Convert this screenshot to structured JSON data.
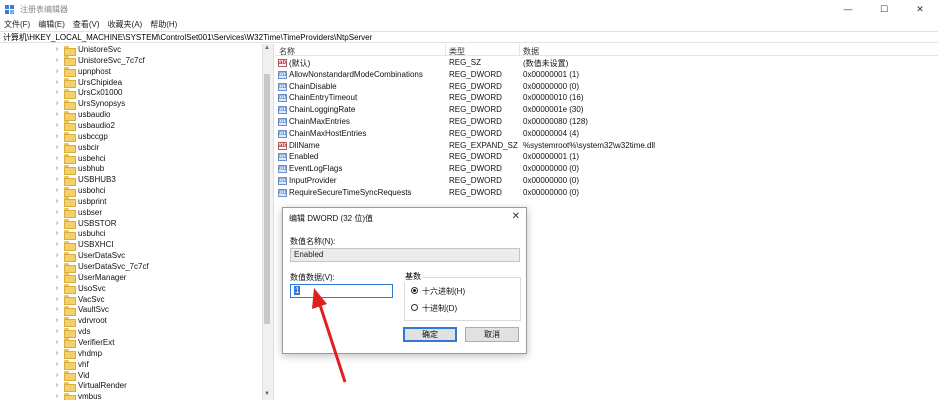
{
  "window": {
    "title": "注册表编辑器",
    "controls": {
      "minimize": "—",
      "maximize": "☐",
      "close": "✕"
    }
  },
  "menu": [
    "文件(F)",
    "编辑(E)",
    "查看(V)",
    "收藏夹(A)",
    "帮助(H)"
  ],
  "address": "计算机\\HKEY_LOCAL_MACHINE\\SYSTEM\\ControlSet001\\Services\\W32Time\\TimeProviders\\NtpServer",
  "tree": {
    "items": [
      "UnistoreSvc",
      "UnistoreSvc_7c7cf",
      "upnphost",
      "UrsChipidea",
      "UrsCx01000",
      "UrsSynopsys",
      "usbaudio",
      "usbaudio2",
      "usbccgp",
      "usbcir",
      "usbehci",
      "usbhub",
      "USBHUB3",
      "usbohci",
      "usbprint",
      "usbser",
      "USBSTOR",
      "usbuhci",
      "USBXHCI",
      "UserDataSvc",
      "UserDataSvc_7c7cf",
      "UserManager",
      "UsoSvc",
      "VacSvc",
      "VaultSvc",
      "vdrvroot",
      "vds",
      "VerifierExt",
      "vhdmp",
      "vhf",
      "Vid",
      "VirtualRender",
      "vmbus"
    ],
    "chevron": "›"
  },
  "values": {
    "headers": {
      "name": "名称",
      "type": "类型",
      "data": "数据"
    },
    "rows": [
      {
        "icon": "string-value-icon",
        "glyph": "ab",
        "name": "(默认)",
        "type": "REG_SZ",
        "data": "(数值未设置)"
      },
      {
        "icon": "dword-value-icon",
        "glyph": "011",
        "name": "AllowNonstandardModeCombinations",
        "type": "REG_DWORD",
        "data": "0x00000001 (1)"
      },
      {
        "icon": "dword-value-icon",
        "glyph": "011",
        "name": "ChainDisable",
        "type": "REG_DWORD",
        "data": "0x00000000 (0)"
      },
      {
        "icon": "dword-value-icon",
        "glyph": "011",
        "name": "ChainEntryTimeout",
        "type": "REG_DWORD",
        "data": "0x00000010 (16)"
      },
      {
        "icon": "dword-value-icon",
        "glyph": "011",
        "name": "ChainLoggingRate",
        "type": "REG_DWORD",
        "data": "0x0000001e (30)"
      },
      {
        "icon": "dword-value-icon",
        "glyph": "011",
        "name": "ChainMaxEntries",
        "type": "REG_DWORD",
        "data": "0x00000080 (128)"
      },
      {
        "icon": "dword-value-icon",
        "glyph": "011",
        "name": "ChainMaxHostEntries",
        "type": "REG_DWORD",
        "data": "0x00000004 (4)"
      },
      {
        "icon": "string-value-icon",
        "glyph": "ab",
        "name": "DllName",
        "type": "REG_EXPAND_SZ",
        "data": "%systemroot%\\system32\\w32time.dll"
      },
      {
        "icon": "dword-value-icon",
        "glyph": "011",
        "name": "Enabled",
        "type": "REG_DWORD",
        "data": "0x00000001 (1)"
      },
      {
        "icon": "dword-value-icon",
        "glyph": "011",
        "name": "EventLogFlags",
        "type": "REG_DWORD",
        "data": "0x00000000 (0)"
      },
      {
        "icon": "dword-value-icon",
        "glyph": "011",
        "name": "InputProvider",
        "type": "REG_DWORD",
        "data": "0x00000000 (0)"
      },
      {
        "icon": "dword-value-icon",
        "glyph": "011",
        "name": "RequireSecureTimeSyncRequests",
        "type": "REG_DWORD",
        "data": "0x00000000 (0)"
      }
    ]
  },
  "dialog": {
    "title": "编辑 DWORD (32 位)值",
    "close": "✕",
    "name_label": "数值名称(N):",
    "name_value": "Enabled",
    "data_label": "数值数据(V):",
    "data_value": "1",
    "base_label": "基数",
    "hex_label": "十六进制(H)",
    "dec_label": "十进制(D)",
    "hex_selected": true,
    "ok": "确定",
    "cancel": "取消"
  },
  "colors": {
    "accent": "#2f7ad6",
    "annotation": "#e02020"
  }
}
